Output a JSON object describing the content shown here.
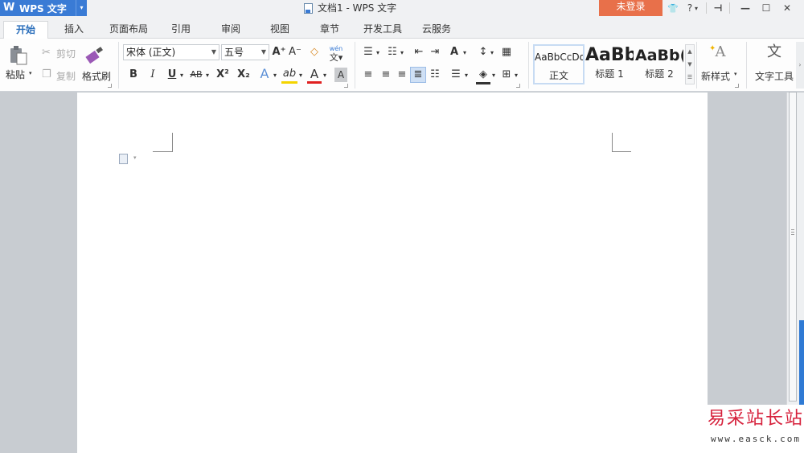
{
  "app": {
    "logo": "W",
    "name": "WPS 文字",
    "drop": "▾"
  },
  "window": {
    "title": "文档1 - WPS 文字",
    "login": "未登录",
    "shirt": "👕",
    "help": "?",
    "help_drop": "▾",
    "pin": "⊣",
    "min": "—",
    "max": "☐",
    "close": "✕"
  },
  "tabs": [
    "开始",
    "插入",
    "页面布局",
    "引用",
    "审阅",
    "视图",
    "章节",
    "开发工具",
    "云服务"
  ],
  "clipboard": {
    "paste": "粘贴",
    "cut": "剪切",
    "copy": "复制",
    "format_painter": "格式刷"
  },
  "font": {
    "name": "宋体 (正文)",
    "size": "五号",
    "grow": "A⁺",
    "shrink": "A⁻",
    "clear": "◇",
    "phonetic": "wén",
    "bold": "B",
    "italic": "I",
    "underline": "U",
    "strike": "AB",
    "superscript": "X²",
    "subscript": "X₂",
    "effect": "A",
    "highlight": "ab",
    "color": "A",
    "shade": "A"
  },
  "paragraph": {
    "bullets": "☰",
    "numbering": "☷",
    "outdent": "⇤",
    "indent": "⇥",
    "text_size": "A",
    "sort": "↕",
    "table": "▦",
    "align_left": "≡",
    "align_center": "≡",
    "align_right": "≡",
    "justify": "≣",
    "distributed": "☷",
    "line_spacing": "☰",
    "fill": "◈",
    "border": "⊞"
  },
  "styles": [
    {
      "preview": "AaBbCcDd",
      "name": "正文"
    },
    {
      "preview": "AaBb",
      "name": "标题 1"
    },
    {
      "preview": "AaBb(",
      "name": "标题 2"
    }
  ],
  "new_style": "新样式",
  "text_tools": "文字工具",
  "watermark": {
    "title": "易采站长站",
    "url": "www.easck.com"
  },
  "colors": {
    "accent": "#3a7bd5",
    "login": "#e8704a",
    "highlight": "#f4d400",
    "font_color": "#e02020"
  }
}
